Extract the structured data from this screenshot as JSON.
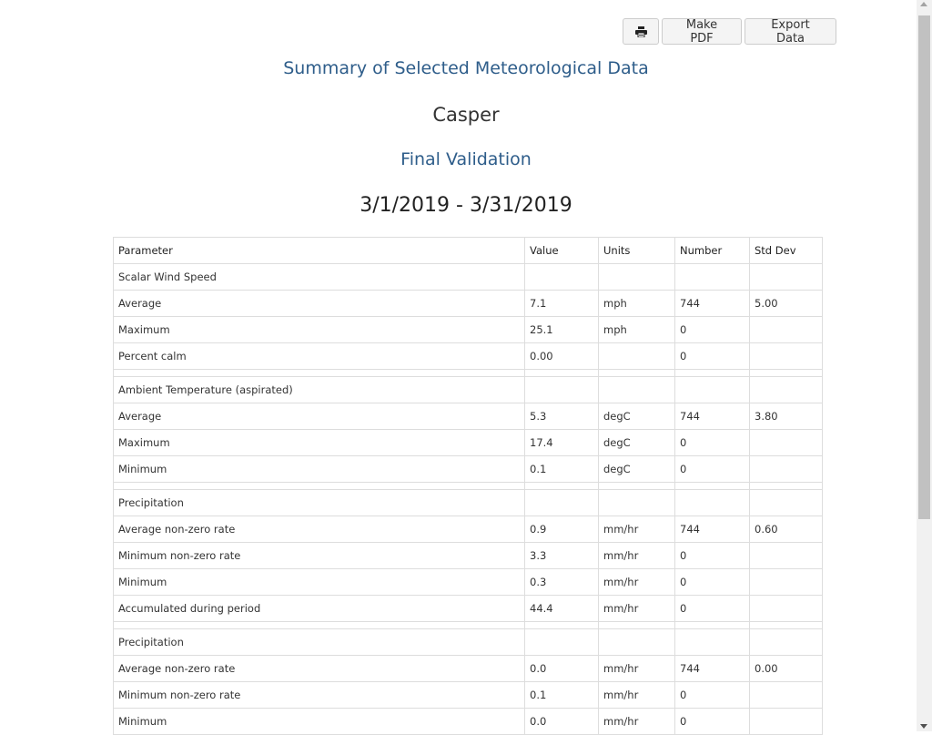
{
  "toolbar": {
    "print_icon": "printer-icon",
    "make_pdf_label": "Make PDF",
    "export_data_label": "Export Data"
  },
  "header": {
    "summary_title": "Summary of Selected Meteorological Data",
    "site": "Casper",
    "validation": "Final Validation",
    "date_range": "3/1/2019 - 3/31/2019"
  },
  "table": {
    "columns": [
      "Parameter",
      "Value",
      "Units",
      "Number",
      "Std Dev"
    ],
    "rows": [
      {
        "type": "group",
        "parameter": "Scalar Wind Speed",
        "value": "",
        "units": "",
        "number": "",
        "std_dev": ""
      },
      {
        "type": "data",
        "parameter": "Average",
        "value": "7.1",
        "units": "mph",
        "number": "744",
        "std_dev": "5.00"
      },
      {
        "type": "data",
        "parameter": "Maximum",
        "value": "25.1",
        "units": "mph",
        "number": "0",
        "std_dev": ""
      },
      {
        "type": "data",
        "parameter": "Percent calm",
        "value": "0.00",
        "units": "",
        "number": "0",
        "std_dev": ""
      },
      {
        "type": "spacer"
      },
      {
        "type": "group",
        "parameter": "Ambient Temperature (aspirated)",
        "value": "",
        "units": "",
        "number": "",
        "std_dev": ""
      },
      {
        "type": "data",
        "parameter": "Average",
        "value": "5.3",
        "units": "degC",
        "number": "744",
        "std_dev": "3.80"
      },
      {
        "type": "data",
        "parameter": "Maximum",
        "value": "17.4",
        "units": "degC",
        "number": "0",
        "std_dev": ""
      },
      {
        "type": "data",
        "parameter": "Minimum",
        "value": "0.1",
        "units": "degC",
        "number": "0",
        "std_dev": ""
      },
      {
        "type": "spacer"
      },
      {
        "type": "group",
        "parameter": "Precipitation",
        "value": "",
        "units": "",
        "number": "",
        "std_dev": ""
      },
      {
        "type": "data",
        "parameter": "Average non-zero rate",
        "value": "0.9",
        "units": "mm/hr",
        "number": "744",
        "std_dev": "0.60"
      },
      {
        "type": "data",
        "parameter": "Minimum non-zero rate",
        "value": "3.3",
        "units": "mm/hr",
        "number": "0",
        "std_dev": ""
      },
      {
        "type": "data",
        "parameter": "Minimum",
        "value": "0.3",
        "units": "mm/hr",
        "number": "0",
        "std_dev": ""
      },
      {
        "type": "data",
        "parameter": "Accumulated during period",
        "value": "44.4",
        "units": "mm/hr",
        "number": "0",
        "std_dev": ""
      },
      {
        "type": "spacer"
      },
      {
        "type": "group",
        "parameter": "Precipitation",
        "value": "",
        "units": "",
        "number": "",
        "std_dev": ""
      },
      {
        "type": "data",
        "parameter": "Average non-zero rate",
        "value": "0.0",
        "units": "mm/hr",
        "number": "744",
        "std_dev": "0.00"
      },
      {
        "type": "data",
        "parameter": "Minimum non-zero rate",
        "value": "0.1",
        "units": "mm/hr",
        "number": "0",
        "std_dev": ""
      },
      {
        "type": "data",
        "parameter": "Minimum",
        "value": "0.0",
        "units": "mm/hr",
        "number": "0",
        "std_dev": ""
      }
    ]
  },
  "colors": {
    "heading_blue": "#2e5d8a",
    "heading_dark": "#222222",
    "border": "#dddddd"
  }
}
